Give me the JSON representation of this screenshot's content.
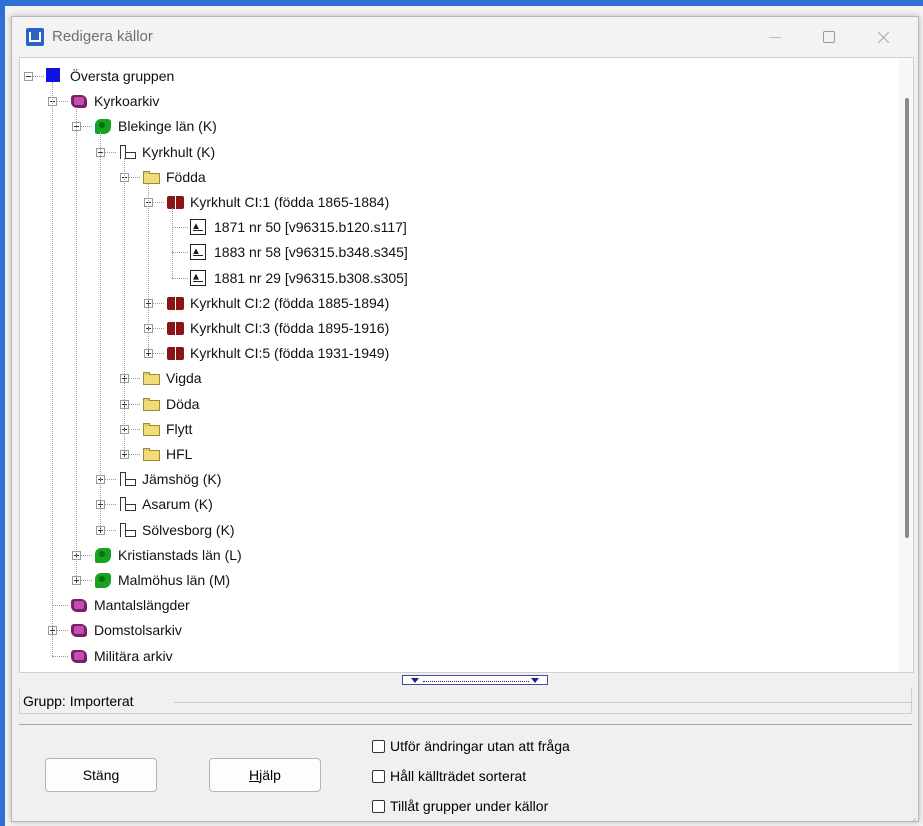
{
  "window": {
    "title": "Redigera källor",
    "controls": [
      "minimize-icon",
      "maximize-icon",
      "close-icon"
    ]
  },
  "tree": [
    {
      "label": "Översta gruppen",
      "icon": "group-square-icon",
      "level": 0,
      "state": "expanded"
    },
    {
      "label": "Kyrkoarkiv",
      "icon": "archive-icon",
      "level": 1,
      "state": "expanded"
    },
    {
      "label": "Blekinge län (K)",
      "icon": "region-icon",
      "level": 2,
      "state": "expanded"
    },
    {
      "label": "Kyrkhult (K)",
      "icon": "church-icon",
      "level": 3,
      "state": "expanded"
    },
    {
      "label": "Födda",
      "icon": "folder-icon",
      "level": 4,
      "state": "expanded"
    },
    {
      "label": "Kyrkhult CI:1 (födda 1865-1884)",
      "icon": "book-icon",
      "level": 5,
      "state": "expanded"
    },
    {
      "label": "1871 nr 50 [v96315.b120.s117]",
      "icon": "document-icon",
      "level": 6,
      "state": "leaf"
    },
    {
      "label": "1883 nr 58 [v96315.b348.s345]",
      "icon": "document-icon",
      "level": 6,
      "state": "leaf"
    },
    {
      "label": "1881 nr 29 [v96315.b308.s305]",
      "icon": "document-icon",
      "level": 6,
      "state": "leaf"
    },
    {
      "label": "Kyrkhult CI:2 (födda 1885-1894)",
      "icon": "book-icon",
      "level": 5,
      "state": "collapsed"
    },
    {
      "label": "Kyrkhult CI:3 (födda 1895-1916)",
      "icon": "book-icon",
      "level": 5,
      "state": "collapsed"
    },
    {
      "label": "Kyrkhult CI:5 (födda 1931-1949)",
      "icon": "book-icon",
      "level": 5,
      "state": "collapsed"
    },
    {
      "label": "Vigda",
      "icon": "folder-icon",
      "level": 4,
      "state": "collapsed"
    },
    {
      "label": "Döda",
      "icon": "folder-icon",
      "level": 4,
      "state": "collapsed"
    },
    {
      "label": "Flytt",
      "icon": "folder-icon",
      "level": 4,
      "state": "collapsed"
    },
    {
      "label": "HFL",
      "icon": "folder-icon",
      "level": 4,
      "state": "collapsed"
    },
    {
      "label": "Jämshög (K)",
      "icon": "church-icon",
      "level": 3,
      "state": "collapsed"
    },
    {
      "label": "Asarum (K)",
      "icon": "church-icon",
      "level": 3,
      "state": "collapsed"
    },
    {
      "label": "Sölvesborg (K)",
      "icon": "church-icon",
      "level": 3,
      "state": "collapsed"
    },
    {
      "label": "Kristianstads län (L)",
      "icon": "region-icon",
      "level": 2,
      "state": "collapsed"
    },
    {
      "label": "Malmöhus län (M)",
      "icon": "region-icon",
      "level": 2,
      "state": "collapsed"
    },
    {
      "label": "Mantalslängder",
      "icon": "archive-icon",
      "level": 1,
      "state": "leaf"
    },
    {
      "label": "Domstolsarkiv",
      "icon": "archive-icon",
      "level": 1,
      "state": "collapsed"
    },
    {
      "label": "Militära arkiv",
      "icon": "archive-icon",
      "level": 1,
      "state": "leaf"
    }
  ],
  "group_status": "Grupp: Importerat",
  "buttons": {
    "close_label": "Stäng",
    "help_label_accel": "H",
    "help_label_rest": "jälp"
  },
  "options": [
    {
      "label": "Utför ändringar utan att fråga",
      "checked": false
    },
    {
      "label": "Håll källträdet sorterat",
      "checked": false
    },
    {
      "label": "Tillåt grupper under källor",
      "checked": false
    }
  ],
  "colors": {
    "accent_border": "#2f6fd6",
    "group_square": "#1010e0",
    "archive": "#7a1f6a",
    "region": "#17a21f",
    "book": "#8b1414",
    "folder": "#f0dc7a"
  }
}
